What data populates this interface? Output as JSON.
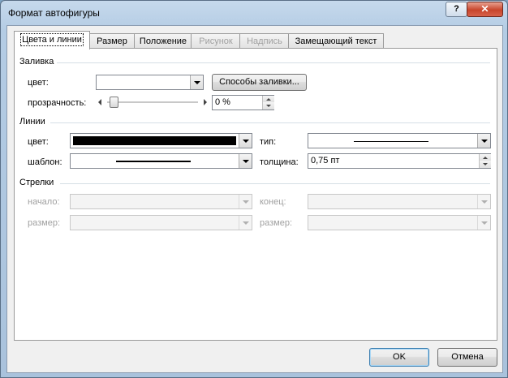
{
  "window": {
    "title": "Формат автофигуры",
    "help_label": "?",
    "close_label": "✕"
  },
  "tabs": [
    {
      "label": "Цвета и линии",
      "active": true,
      "enabled": true
    },
    {
      "label": "Размер",
      "enabled": true
    },
    {
      "label": "Положение",
      "enabled": true
    },
    {
      "label": "Рисунок",
      "enabled": false
    },
    {
      "label": "Надпись",
      "enabled": false
    },
    {
      "label": "Замещающий текст",
      "enabled": true
    }
  ],
  "fill": {
    "group_label": "Заливка",
    "color_label": "цвет:",
    "color_value": "",
    "methods_button": "Способы заливки...",
    "transparency_label": "прозрачность:",
    "transparency_value": "0 %",
    "transparency_level": 0
  },
  "lines": {
    "group_label": "Линии",
    "color_label": "цвет:",
    "color_value": "#000000",
    "type_label": "тип:",
    "pattern_label": "шаблон:",
    "weight_label": "толщина:",
    "weight_value": "0,75 пт"
  },
  "arrows": {
    "group_label": "Стрелки",
    "start_label": "начало:",
    "end_label": "конец:",
    "start_size_label": "размер:",
    "end_size_label": "размер:"
  },
  "footer": {
    "ok_label": "OK",
    "cancel_label": "Отмена"
  }
}
